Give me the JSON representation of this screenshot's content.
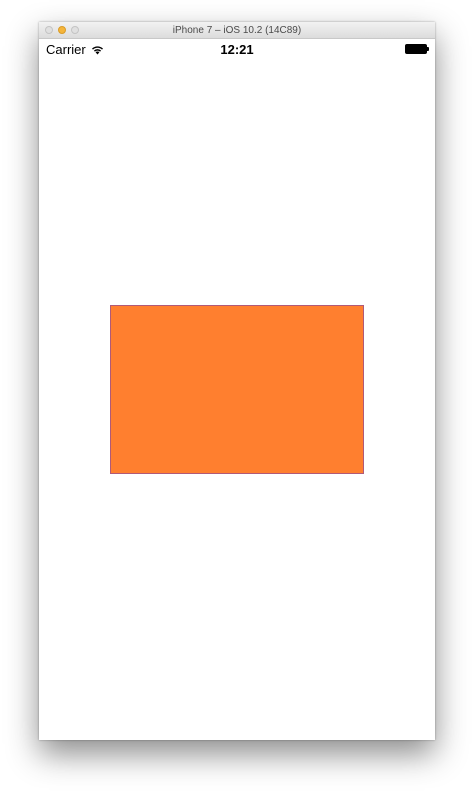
{
  "window": {
    "title": "iPhone 7 – iOS 10.2 (14C89)"
  },
  "status_bar": {
    "carrier": "Carrier",
    "time": "12:21",
    "icons": [
      "wifi-icon",
      "battery-icon"
    ]
  },
  "colors": {
    "view_fill": "#ff7f2f",
    "view_border": "#b05a78",
    "traffic_close": "#e0e0e0",
    "traffic_minimize": "#f5b53b",
    "traffic_zoom": "#e0e0e0"
  }
}
